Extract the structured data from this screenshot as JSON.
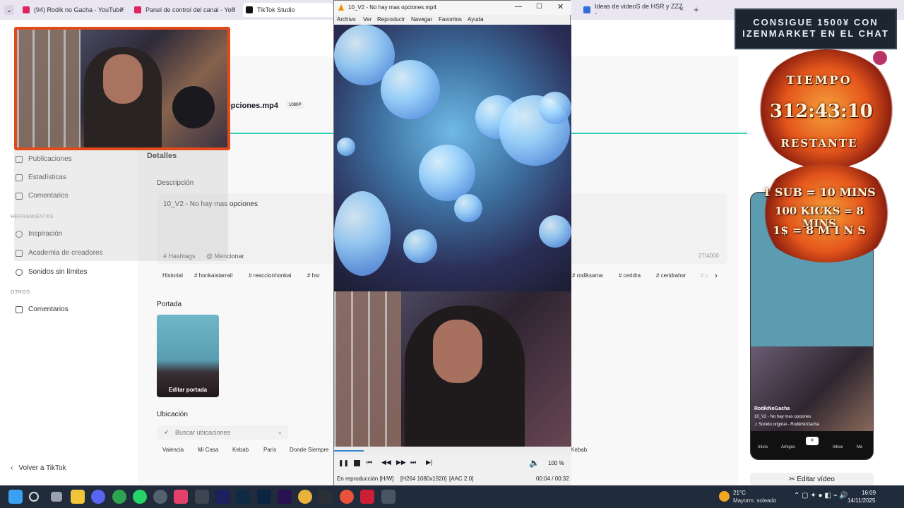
{
  "browser": {
    "tabs": [
      {
        "label": "(94) Rodik no Gacha - YouTube",
        "color": "#e0245e"
      },
      {
        "label": "Panel de control del canal - You",
        "color": "#e0245e"
      },
      {
        "label": "TikTok Studio",
        "color": "#111111"
      },
      {
        "label": "Ideas de videoS de HSR y ZZZ -",
        "color": "#2f6fd8"
      }
    ],
    "new_tab": "+"
  },
  "sidebar": {
    "items": [
      "Publicaciones",
      "Estadísticas",
      "Comentarios"
    ],
    "tools_header": "HERRAMIENTAS",
    "tools": [
      "Inspiración",
      "Academia de creadores",
      "Sonidos sin límites"
    ],
    "others_header": "OTROS",
    "others": [
      "Comentarios"
    ],
    "back": "Volver a TikTok"
  },
  "upload": {
    "filename": "opciones.mp4",
    "quality": "1080P",
    "details": "Detalles",
    "description_label": "Descripción",
    "description": "10_V2 - No hay mas opciones",
    "hashtags": "# Hashtags",
    "mention": "@ Mencionar",
    "counter": "27/4000",
    "chips": [
      "Historial",
      "# honkaistarrail",
      "# reaccionhonkai",
      "# hsr",
      "# rodiksama",
      "# ceridra",
      "# ceridrahsr",
      "# c"
    ],
    "cover_label": "Portada",
    "edit_cover": "Editar portada",
    "location_label": "Ubicación",
    "location_placeholder": "Buscar ubicaciones",
    "locations": [
      "Valencia",
      "Mi Casa",
      "Kebab",
      "Paris",
      "Donde Siempre",
      "Kebab"
    ],
    "edit_video": "Editar vídeo"
  },
  "vlc": {
    "title": "10_V2 - No hay mas opciones.mp4",
    "menu": [
      "Archivo",
      "Ver",
      "Reproducir",
      "Navegar",
      "Favoritos",
      "Ayuda"
    ],
    "volume": "100 %",
    "status_left": "En reproducción [H/W]",
    "codec": "[H264 1080x1920]",
    "audio": "[AAC 2.0]",
    "time": "00:04 / 00:32",
    "progress": 0.125
  },
  "overlay": {
    "promo": "CONSIGUE 1500¥ CON IZENMARKET EN EL CHAT",
    "timer_title": "TIEMPO",
    "timer": "312:43:10",
    "timer_sub": "RESTANTE",
    "rule1": "1 SUB = 10 MINS",
    "rule2": "100 KICKS = 8 MINS",
    "rule3": "1$ = 8 M I N S"
  },
  "phone": {
    "user": "RodikNoGacha",
    "caption": "10_V2 - No hay mas opciones",
    "sound": "♫ Sonido original - RodikNoGacha",
    "nav": [
      "Inicio",
      "Amigos",
      "+",
      "Inbox",
      "Me"
    ]
  },
  "taskbar": {
    "weather_temp": "21°C",
    "weather_desc": "Mayorm. soleado",
    "time": "16:09",
    "date": "14/11/2025"
  }
}
